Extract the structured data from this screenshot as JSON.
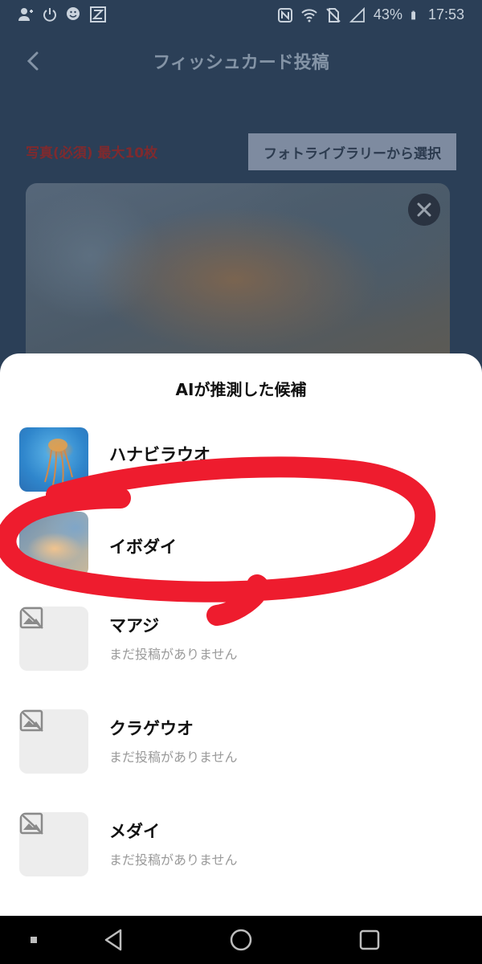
{
  "status_bar": {
    "battery": "43%",
    "time": "17:53",
    "left_icons": [
      "person-add-icon",
      "power-icon",
      "smile-download-icon",
      "z-app-icon"
    ],
    "right_icons": [
      "nfc-icon",
      "wifi-icon",
      "no-sim-icon",
      "signal-icon",
      "battery-icon"
    ]
  },
  "header": {
    "title": "フィッシュカード投稿",
    "back_icon": "chevron-left-icon"
  },
  "photo_section": {
    "label": "写真(必須) 最大10枚",
    "library_button": "フォトライブラリーから選択",
    "close_icon": "close-icon"
  },
  "sheet": {
    "title": "AIが推測した候補",
    "candidates": [
      {
        "name": "ハナビラウオ",
        "subtitle": "",
        "thumbnail": "jellyfish-photo"
      },
      {
        "name": "イボダイ",
        "subtitle": "",
        "thumbnail": "fish-photo"
      },
      {
        "name": "マアジ",
        "subtitle": "まだ投稿がありません",
        "thumbnail": "no-image-icon"
      },
      {
        "name": "クラゲウオ",
        "subtitle": "まだ投稿がありません",
        "thumbnail": "no-image-icon"
      },
      {
        "name": "メダイ",
        "subtitle": "まだ投稿がありません",
        "thumbnail": "no-image-icon"
      }
    ]
  },
  "annotation": {
    "color": "#ee1c2e"
  },
  "nav_bar": {
    "icons": [
      "dot-icon",
      "back-triangle-icon",
      "home-circle-icon",
      "recents-square-icon"
    ]
  }
}
